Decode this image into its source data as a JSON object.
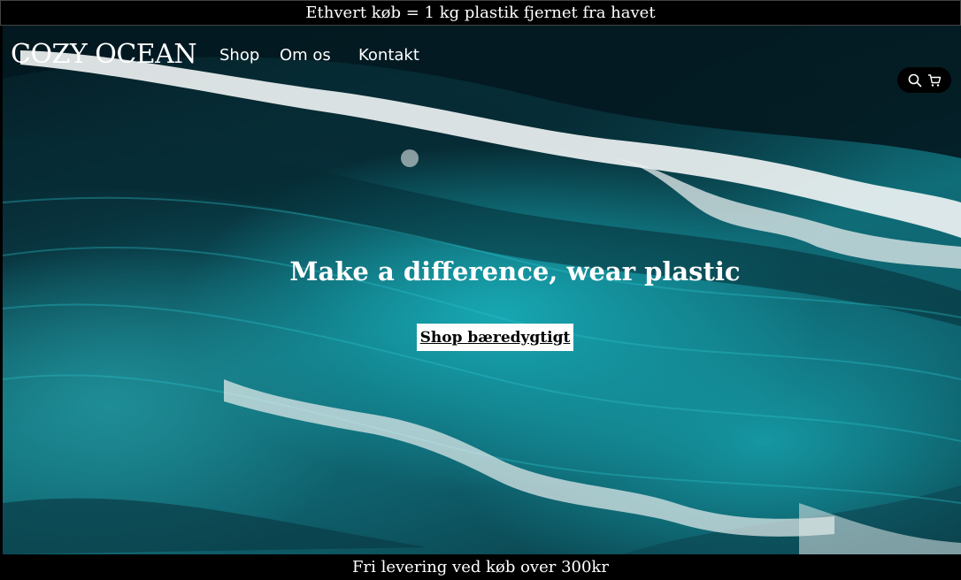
{
  "announcement_top": "Ethvert køb = 1 kg plastik fjernet fra havet",
  "announcement_bottom": "Fri levering ved køb over 300kr",
  "header": {
    "logo": "COZY OCEAN",
    "nav": [
      "Shop",
      "Om os",
      "Kontakt"
    ],
    "icons": [
      "search-icon",
      "cart-icon"
    ]
  },
  "hero": {
    "headline": "Make a difference, wear plastic",
    "cta_label": "Shop bæredygtigt"
  },
  "colors": {
    "bar_background": "#000000",
    "text": "#ffffff",
    "ocean_teal": "#17a7b2",
    "ocean_dark": "#041c24",
    "cta_background": "#ffffff"
  }
}
